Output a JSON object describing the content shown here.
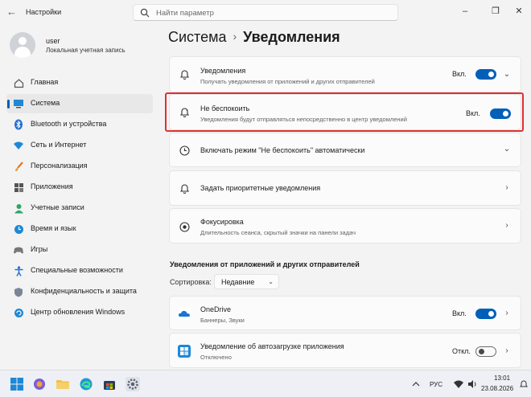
{
  "window": {
    "title": "Настройки",
    "search_placeholder": "Найти параметр"
  },
  "user": {
    "name": "user",
    "account_type": "Локальная учетная запись"
  },
  "sidebar": {
    "items": [
      {
        "label": "Главная",
        "icon": "home-icon"
      },
      {
        "label": "Система",
        "icon": "system-icon",
        "active": true
      },
      {
        "label": "Bluetooth и устройства",
        "icon": "bluetooth-icon"
      },
      {
        "label": "Сеть и Интернет",
        "icon": "network-icon"
      },
      {
        "label": "Персонализация",
        "icon": "brush-icon"
      },
      {
        "label": "Приложения",
        "icon": "apps-icon"
      },
      {
        "label": "Учетные записи",
        "icon": "accounts-icon"
      },
      {
        "label": "Время и язык",
        "icon": "time-language-icon"
      },
      {
        "label": "Игры",
        "icon": "gaming-icon"
      },
      {
        "label": "Специальные возможности",
        "icon": "accessibility-icon"
      },
      {
        "label": "Конфиденциальность и защита",
        "icon": "shield-icon"
      },
      {
        "label": "Центр обновления Windows",
        "icon": "update-icon"
      }
    ]
  },
  "breadcrumb": {
    "parent": "Система",
    "separator": "›",
    "current": "Уведомления"
  },
  "settings": {
    "notifications": {
      "title": "Уведомления",
      "subtitle": "Получать уведомления от приложений и других отправителей",
      "state": "Вкл."
    },
    "dnd": {
      "title": "Не беспокоить",
      "subtitle": "Уведомления будут отправляться непосредственно в центр уведомлений",
      "state": "Вкл."
    },
    "dnd_auto": {
      "title": "Включать режим \"Не беспокоить\" автоматически"
    },
    "priority": {
      "title": "Задать приоритетные уведомления"
    },
    "focus": {
      "title": "Фокусировка",
      "subtitle": "Длительность сеанса, скрытый значки на панели задач"
    }
  },
  "senders": {
    "section_title": "Уведомления от приложений и других отправителей",
    "sort_label": "Сортировка:",
    "sort_value": "Недавние",
    "apps": [
      {
        "name": "OneDrive",
        "subtitle": "Баннеры, Звуки",
        "state": "Вкл."
      },
      {
        "name": "Уведомление об автозагрузке приложения",
        "subtitle": "Отключено",
        "state": "Откл."
      }
    ]
  },
  "tray": {
    "language": "РУС",
    "time": "13:01",
    "date": "23.08.2026"
  },
  "colors": {
    "accent": "#005fb8",
    "highlight": "#e03030"
  }
}
